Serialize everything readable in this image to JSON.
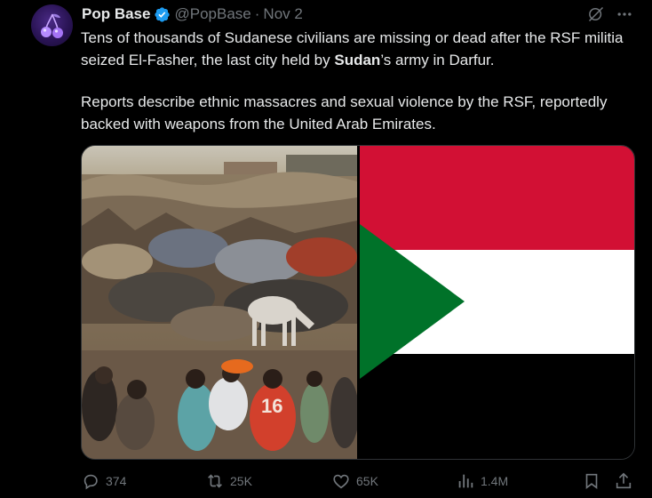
{
  "post": {
    "author_name": "Pop Base",
    "handle": "@PopBase",
    "separator": "·",
    "date": "Nov 2",
    "text_p1_before": "Tens of thousands of Sudanese civilians are missing or dead after the RSF militia seized El-Fasher, the last city held by ",
    "text_p1_bold": "Sudan",
    "text_p1_after": "’s army in Darfur.",
    "text_p2": "Reports describe ethnic massacres and sexual violence by the RSF, reportedly backed with weapons from the United Arab Emirates.",
    "media": [
      {
        "kind": "photo",
        "icon": "photo-displaced-civilians"
      },
      {
        "kind": "photo",
        "icon": "photo-sudan-flag"
      }
    ]
  },
  "actions": {
    "replies": "374",
    "reposts": "25K",
    "likes": "65K",
    "views": "1.4M"
  },
  "icons": {
    "verified": "verified-badge-icon",
    "grok": "grok-icon",
    "more": "more-icon",
    "reply": "reply-icon",
    "repost": "repost-icon",
    "like": "like-icon",
    "views": "views-icon",
    "bookmark": "bookmark-icon",
    "share": "share-icon"
  },
  "colors": {
    "background": "#000000",
    "text": "#e7e9ea",
    "muted": "#71767b",
    "verified": "#1d9bf0",
    "flag_red": "#d21034",
    "flag_white": "#ffffff",
    "flag_black": "#000000",
    "flag_green": "#007229"
  }
}
